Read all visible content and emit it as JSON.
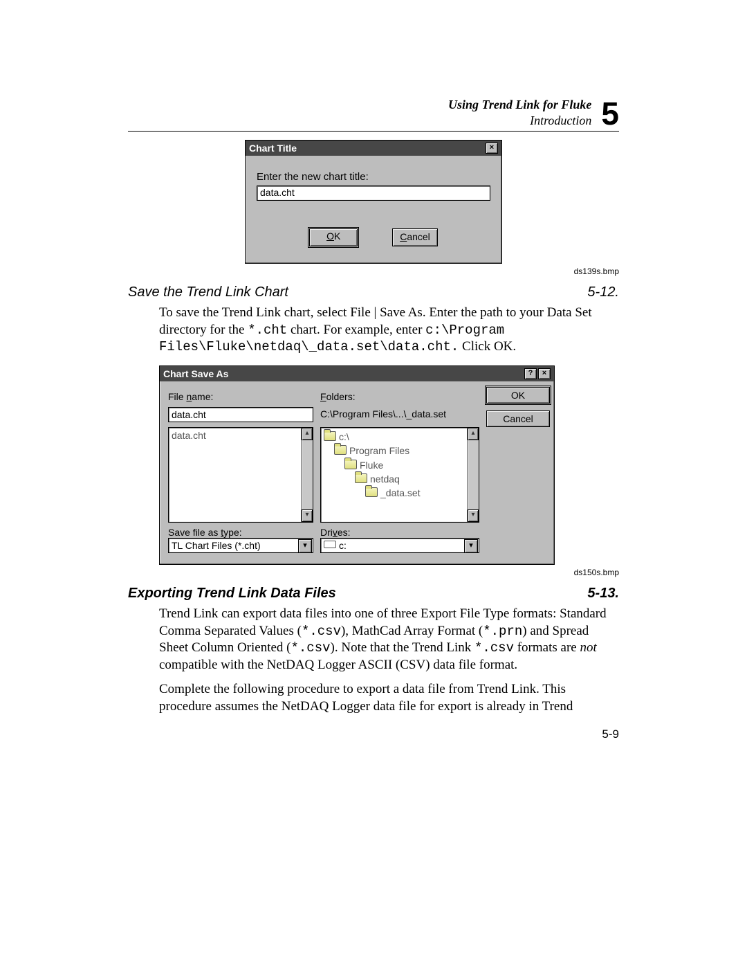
{
  "header": {
    "line1": "Using Trend Link for Fluke",
    "line2": "Introduction",
    "chapter_number": "5"
  },
  "dialog1": {
    "title": "Chart Title",
    "close_glyph": "×",
    "prompt": "Enter the new chart title:",
    "value": "data.cht",
    "ok_u": "O",
    "ok_rest": "K",
    "cancel_u": "C",
    "cancel_rest": "ancel"
  },
  "caption1": "ds139s.bmp",
  "section512": {
    "title": "Save the Trend Link Chart",
    "num": "5-12."
  },
  "para512_pre": "To save the Trend Link chart, select File | Save As. Enter the path to your Data Set directory for the ",
  "para512_code1": "*.cht",
  "para512_mid": " chart. For example, enter ",
  "para512_code2": "c:\\Program Files\\Fluke\\netdaq\\_data.set\\data.cht.",
  "para512_post": " Click OK.",
  "dialog2": {
    "title": "Chart Save As",
    "help_glyph": "?",
    "close_glyph": "×",
    "file_name_label_pre": "File ",
    "file_name_label_u": "n",
    "file_name_label_post": "ame:",
    "file_name_value": "data.cht",
    "list_item": "data.cht",
    "folders_label_u": "F",
    "folders_label_post": "olders:",
    "folders_path": "C:\\Program Files\\...\\_data.set",
    "tree": {
      "l0": "c:\\",
      "l1": "Program Files",
      "l2": "Fluke",
      "l3": "netdaq",
      "l4": "_data.set"
    },
    "save_type_label_pre": "Save file as ",
    "save_type_label_u": "t",
    "save_type_label_post": "ype:",
    "save_type_value": "TL Chart Files (*.cht)",
    "drives_label_pre": "Dri",
    "drives_label_u": "v",
    "drives_label_post": "es:",
    "drives_value": "c:",
    "ok": "OK",
    "cancel": "Cancel",
    "drop_glyph": "▾",
    "up_glyph": "▴"
  },
  "caption2": "ds150s.bmp",
  "section513": {
    "title": "Exporting Trend Link Data Files",
    "num": "5-13."
  },
  "para513a_pre": "Trend Link can export data files into one of three Export File Type formats: Standard Comma Separated Values (",
  "para513a_c1": "*.csv",
  "para513a_m1": "), MathCad Array Format (",
  "para513a_c2": "*.prn",
  "para513a_m2": ") and Spread Sheet Column Oriented (",
  "para513a_c3": "*.csv",
  "para513a_m3": "). Note that the Trend Link ",
  "para513a_c4": "*.csv",
  "para513a_m4": " formats are ",
  "para513a_i": "not",
  "para513a_post": " compatible with the NetDAQ Logger ASCII (CSV) data file format.",
  "para513b": "Complete the following procedure to export a data file from Trend Link. This procedure assumes the NetDAQ Logger data file for export is already in Trend",
  "page_number": "5-9"
}
